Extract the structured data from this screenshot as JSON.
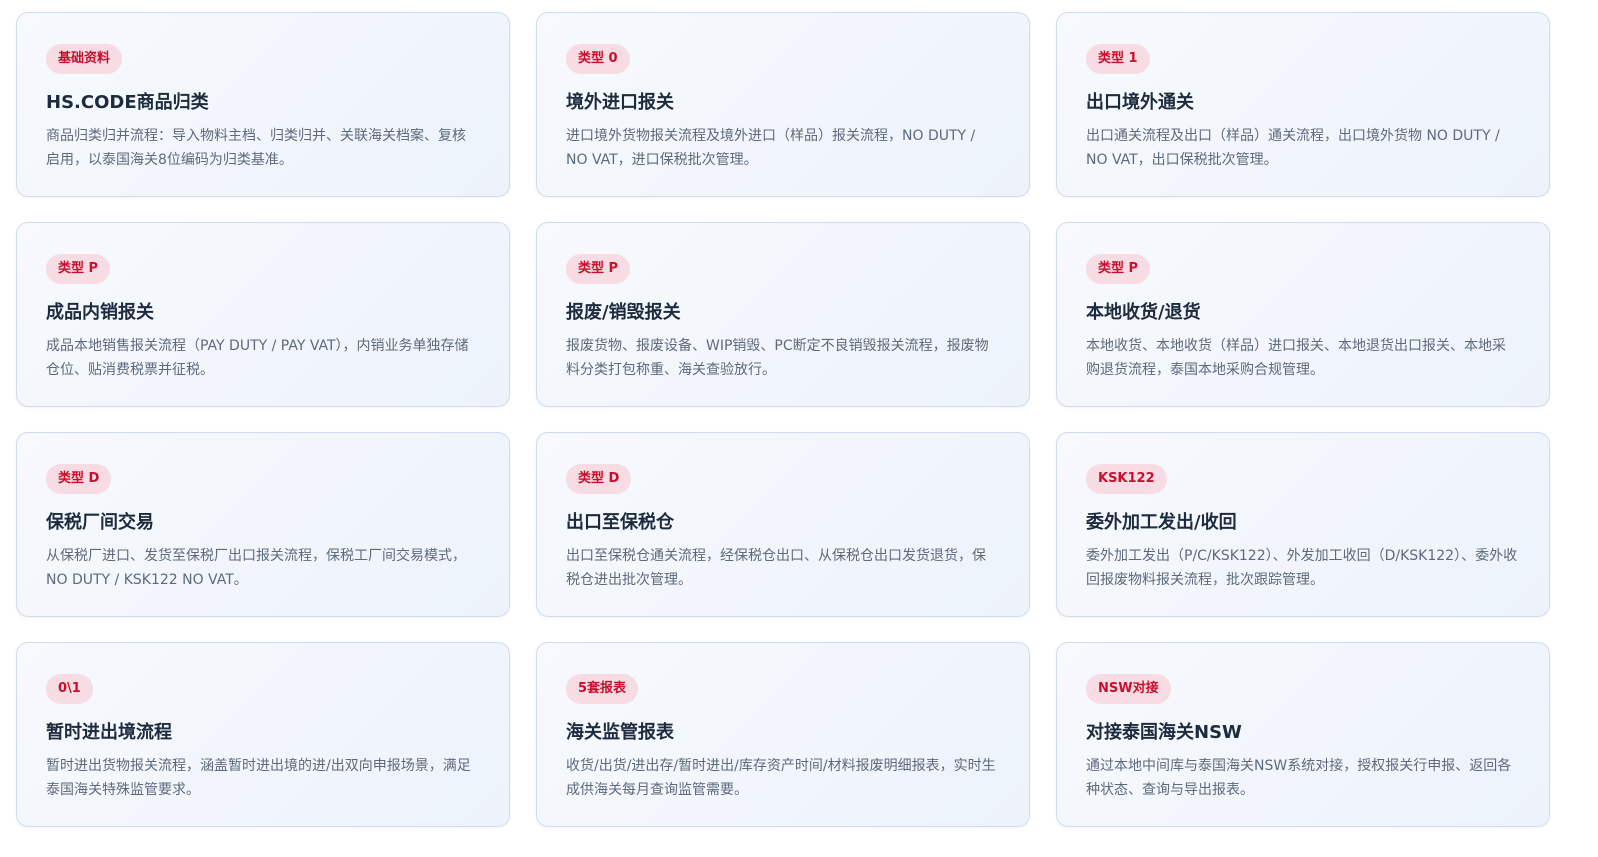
{
  "cards": [
    {
      "tag": "基础资料",
      "title": "HS.CODE商品归类",
      "desc": "商品归类归并流程：导入物料主档、归类归并、关联海关档案、复核启用，以泰国海关8位编码为归类基准。"
    },
    {
      "tag": "类型 0",
      "title": "境外进口报关",
      "desc": "进口境外货物报关流程及境外进口（样品）报关流程，NO DUTY / NO VAT，进口保税批次管理。"
    },
    {
      "tag": "类型 1",
      "title": "出口境外通关",
      "desc": "出口通关流程及出口（样品）通关流程，出口境外货物 NO DUTY / NO VAT，出口保税批次管理。"
    },
    {
      "tag": "类型 P",
      "title": "成品内销报关",
      "desc": "成品本地销售报关流程（PAY DUTY / PAY VAT），内销业务单独存储仓位、贴消费税票并征税。"
    },
    {
      "tag": "类型 P",
      "title": "报废/销毁报关",
      "desc": "报废货物、报废设备、WIP销毁、PC断定不良销毁报关流程，报废物料分类打包称重、海关查验放行。"
    },
    {
      "tag": "类型 P",
      "title": "本地收货/退货",
      "desc": "本地收货、本地收货（样品）进口报关、本地退货出口报关、本地采购退货流程，泰国本地采购合规管理。"
    },
    {
      "tag": "类型 D",
      "title": "保税厂间交易",
      "desc": "从保税厂进口、发货至保税厂出口报关流程，保税工厂间交易模式，NO DUTY / KSK122 NO VAT。"
    },
    {
      "tag": "类型 D",
      "title": "出口至保税仓",
      "desc": "出口至保税仓通关流程，经保税仓出口、从保税仓出口发货退货，保税仓进出批次管理。"
    },
    {
      "tag": "KSK122",
      "title": "委外加工发出/收回",
      "desc": "委外加工发出（P/C/KSK122）、外发加工收回（D/KSK122）、委外收回报废物料报关流程，批次跟踪管理。"
    },
    {
      "tag": "0\\1",
      "title": "暂时进出境流程",
      "desc": "暂时进出货物报关流程，涵盖暂时进出境的进/出双向申报场景，满足泰国海关特殊监管要求。"
    },
    {
      "tag": "5套报表",
      "title": "海关监管报表",
      "desc": "收货/出货/进出存/暂时进出/库存资产时间/材料报废明细报表，实时生成供海关每月查询监管需要。"
    },
    {
      "tag": "NSW对接",
      "title": "对接泰国海关NSW",
      "desc": "通过本地中间库与泰国海关NSW系统对接，授权报关行申报、返回各种状态、查询与导出报表。"
    }
  ]
}
